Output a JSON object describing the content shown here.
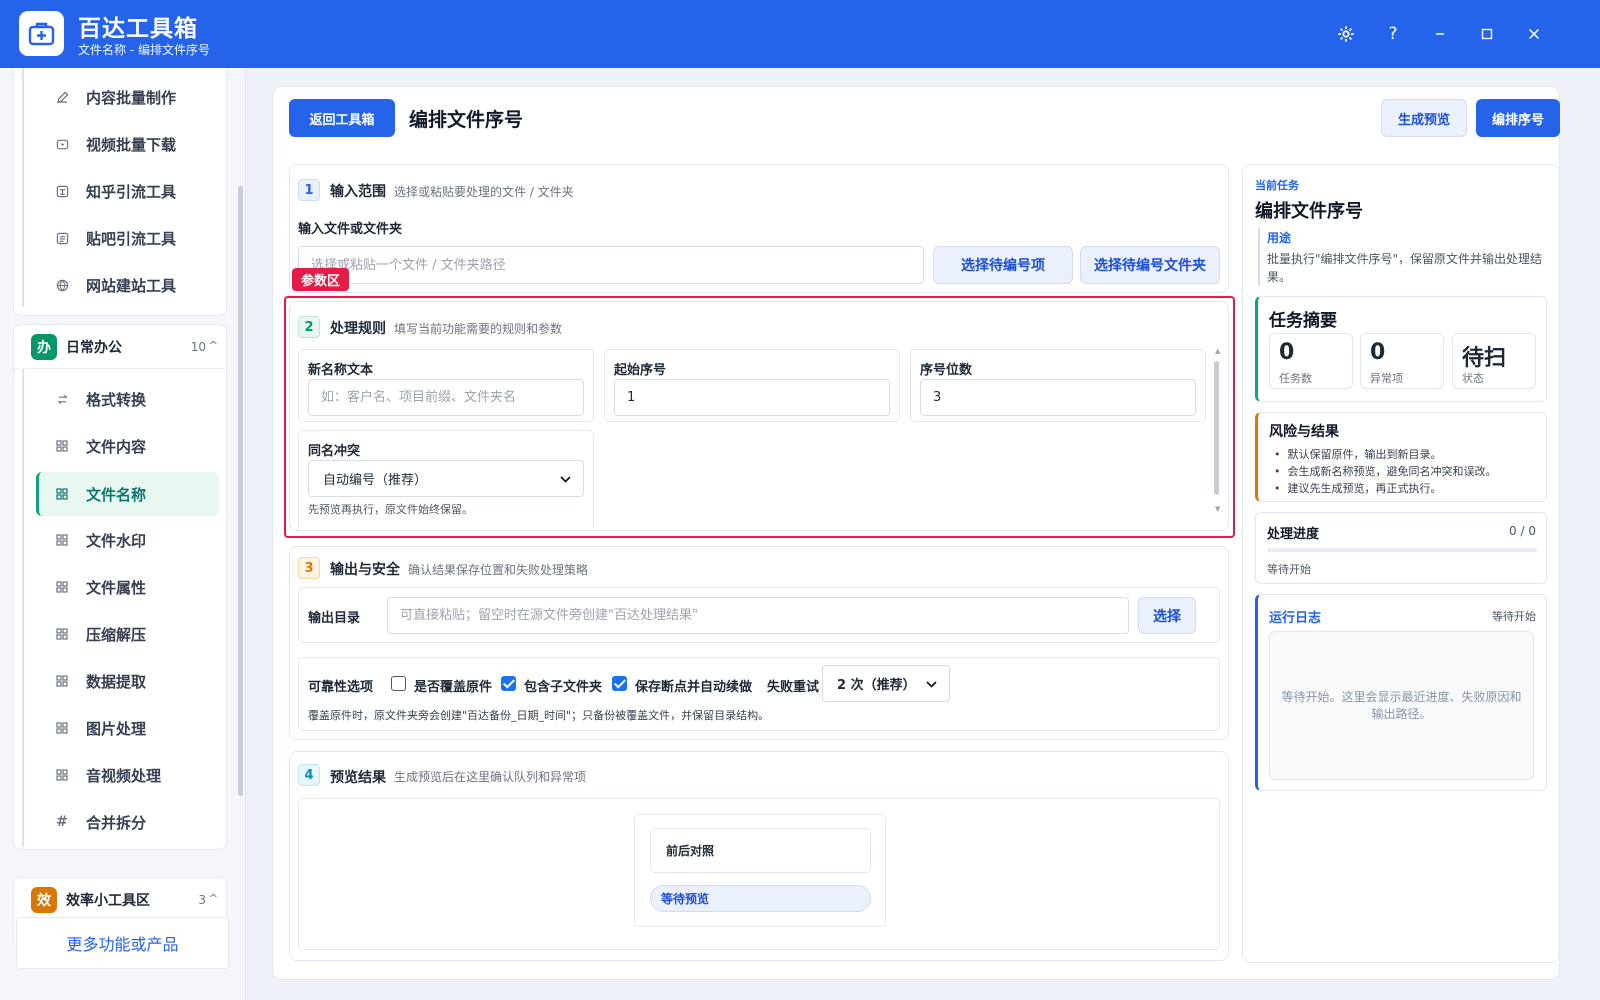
{
  "app": {
    "name": "百达工具箱",
    "subtitle": "文件名称 - 编排文件序号",
    "window_buttons": [
      "gear-icon",
      "help-icon",
      "minimize-icon",
      "maximize-icon",
      "close-icon"
    ]
  },
  "sidebar": {
    "top_items": [
      {
        "label": "内容批量制作",
        "icon": "pen-icon"
      },
      {
        "label": "视频批量下载",
        "icon": "video-icon"
      },
      {
        "label": "知乎引流工具",
        "icon": "zhihu-icon"
      },
      {
        "label": "贴吧引流工具",
        "icon": "tieba-icon"
      },
      {
        "label": "网站建站工具",
        "icon": "globe-icon"
      }
    ],
    "group_office": {
      "badge": "办",
      "title": "日常办公",
      "count": "10",
      "caret": "^",
      "items": [
        {
          "label": "格式转换",
          "icon": "swap-icon"
        },
        {
          "label": "文件内容",
          "icon": "grid-icon"
        },
        {
          "label": "文件名称",
          "icon": "grid-icon",
          "active": true
        },
        {
          "label": "文件水印",
          "icon": "grid-icon"
        },
        {
          "label": "文件属性",
          "icon": "grid-icon"
        },
        {
          "label": "压缩解压",
          "icon": "grid-icon"
        },
        {
          "label": "数据提取",
          "icon": "grid-icon"
        },
        {
          "label": "图片处理",
          "icon": "grid-icon"
        },
        {
          "label": "音视频处理",
          "icon": "grid-icon"
        },
        {
          "label": "合并拆分",
          "icon": "hash-icon"
        }
      ]
    },
    "group_efficiency": {
      "badge": "效",
      "title": "效率小工具区",
      "count": "3",
      "caret": "^"
    },
    "more_link": "更多功能或产品"
  },
  "header": {
    "back_button": "返回工具箱",
    "title": "编排文件序号",
    "preview_button": "生成预览",
    "run_button": "编排序号"
  },
  "section1": {
    "num": "1",
    "title": "输入范围",
    "desc": "选择或粘贴要处理的文件 / 文件夹",
    "field_label": "输入文件或文件夹",
    "input_placeholder": "选择或粘贴一个文件 / 文件夹路径",
    "btn_items": "选择待编号项",
    "btn_folder": "选择待编号文件夹"
  },
  "highlight_tag": "参数区",
  "section2": {
    "num": "2",
    "title": "处理规则",
    "desc": "填写当前功能需要的规则和参数",
    "new_name_label": "新名称文本",
    "new_name_placeholder": "如：客户名、项目前缀、文件夹名",
    "start_label": "起始序号",
    "start_value": "1",
    "digits_label": "序号位数",
    "digits_value": "3",
    "conflict_label": "同名冲突",
    "conflict_selected": "自动编号（推荐）",
    "hint": "先预览再执行，原文件始终保留。"
  },
  "section3": {
    "num": "3",
    "title": "输出与安全",
    "desc": "确认结果保存位置和失败处理策略",
    "output_label": "输出目录",
    "output_placeholder": "可直接粘贴；留空时在源文件旁创建\"百达处理结果\"",
    "select_button": "选择",
    "reliability_label": "可靠性选项",
    "overwrite_label": "是否覆盖原件",
    "overwrite_checked": false,
    "subfolder_label": "包含子文件夹",
    "subfolder_checked": true,
    "resume_label": "保存断点并自动续做",
    "resume_checked": true,
    "retry_label": "失败重试",
    "retry_selected": "2 次（推荐）",
    "note": "覆盖原件时，原文件夹旁会创建\"百达备份_日期_时间\"；只备份被覆盖文件，并保留目录结构。"
  },
  "section4": {
    "num": "4",
    "title": "预览结果",
    "desc": "生成预览后在这里确认队列和异常项",
    "compare_label": "前后对照",
    "status_pill": "等待预览"
  },
  "side": {
    "current_task_label": "当前任务",
    "task_title": "编排文件序号",
    "usage_label": "用途",
    "usage_text": "批量执行\"编排文件序号\"，保留原文件并输出处理结果。",
    "summary_title": "任务摘要",
    "stats": [
      {
        "value": "0",
        "label": "任务数"
      },
      {
        "value": "0",
        "label": "异常项"
      },
      {
        "value": "待扫",
        "label": "状态"
      }
    ],
    "risk_title": "风险与结果",
    "risks": [
      "默认保留原件，输出到新目录。",
      "会生成新名称预览，避免同名冲突和误改。",
      "建议先生成预览，再正式执行。"
    ],
    "progress_title": "处理进度",
    "progress_count": "0 / 0",
    "progress_fraction": 0,
    "progress_status": "等待开始",
    "log_title": "运行日志",
    "log_status": "等待开始",
    "log_placeholder": "等待开始。这里会显示最近进度、失败原因和输出路径。"
  },
  "colors": {
    "brand": "#2563eb",
    "active_green": "#10a37f",
    "highlight_red": "#e11d48",
    "office_badge": "#059669",
    "efficiency_badge": "#d97706"
  }
}
